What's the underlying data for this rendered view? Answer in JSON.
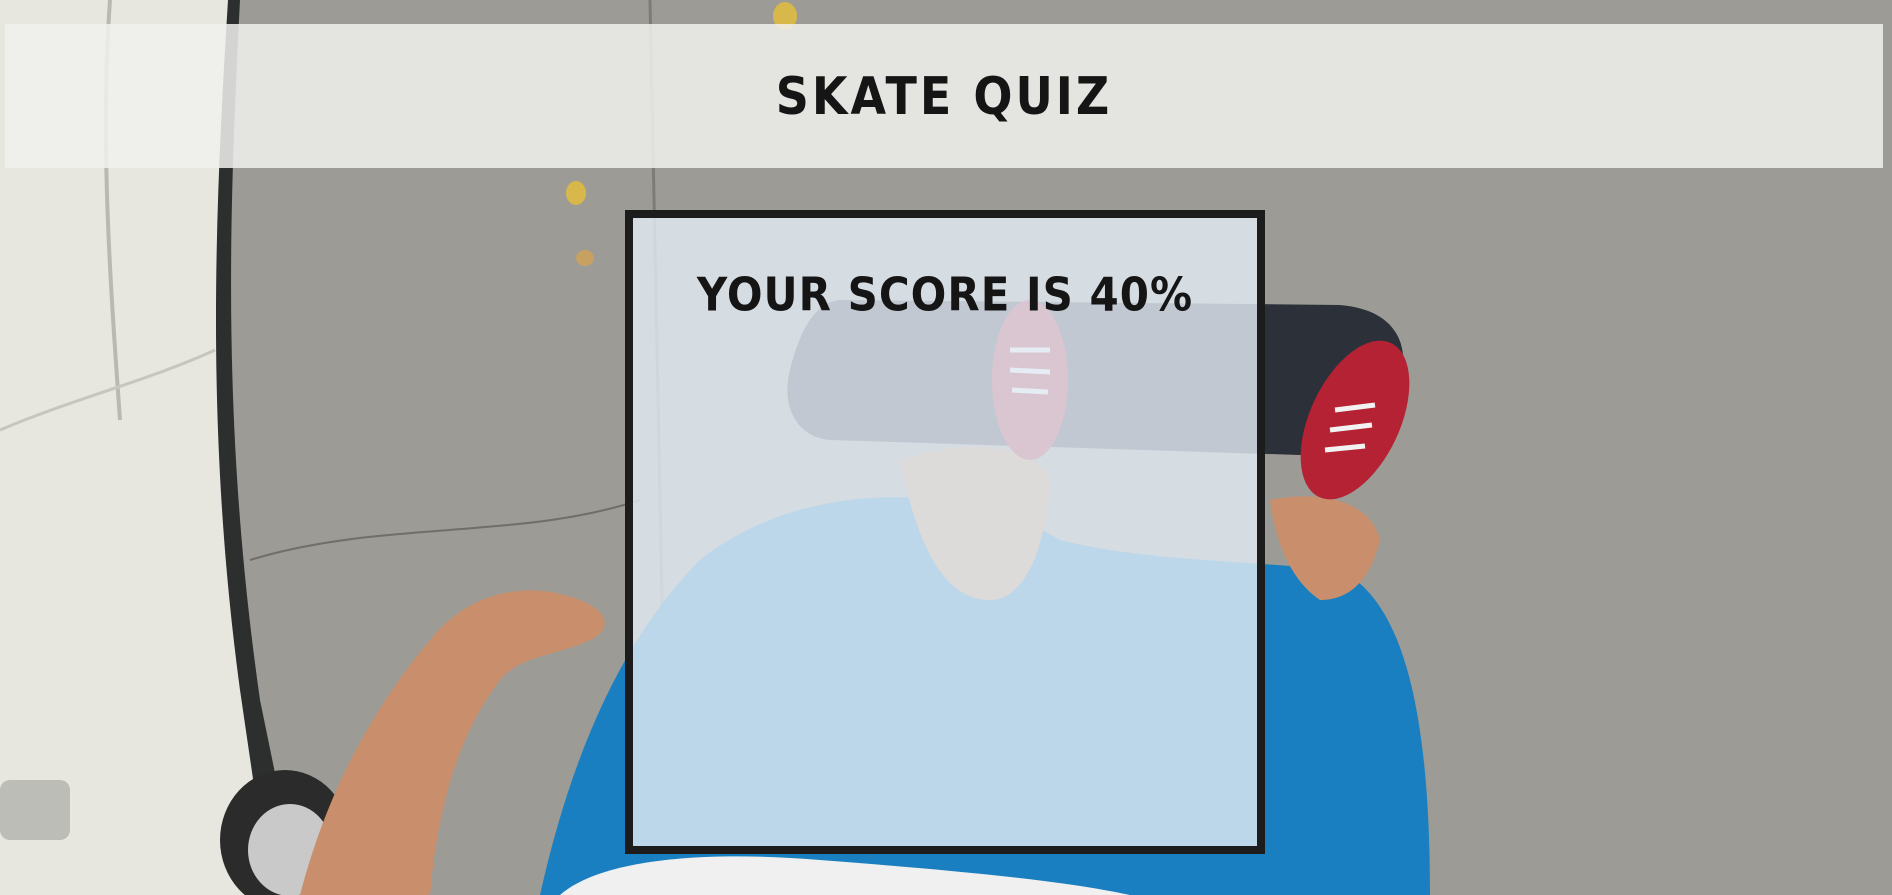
{
  "header": {
    "title": "SKATE QUIZ"
  },
  "result": {
    "score_text": "YOUR SCORE IS 40%"
  },
  "colors": {
    "pavement": "#9b9a95",
    "car": "#e8e8e2",
    "shorts": "#1a7fc0",
    "shoe": "#b52233",
    "skateboard": "#2c3038",
    "skin": "#c98f6c",
    "text": "#151515",
    "panel_border": "#1c1c1c"
  }
}
